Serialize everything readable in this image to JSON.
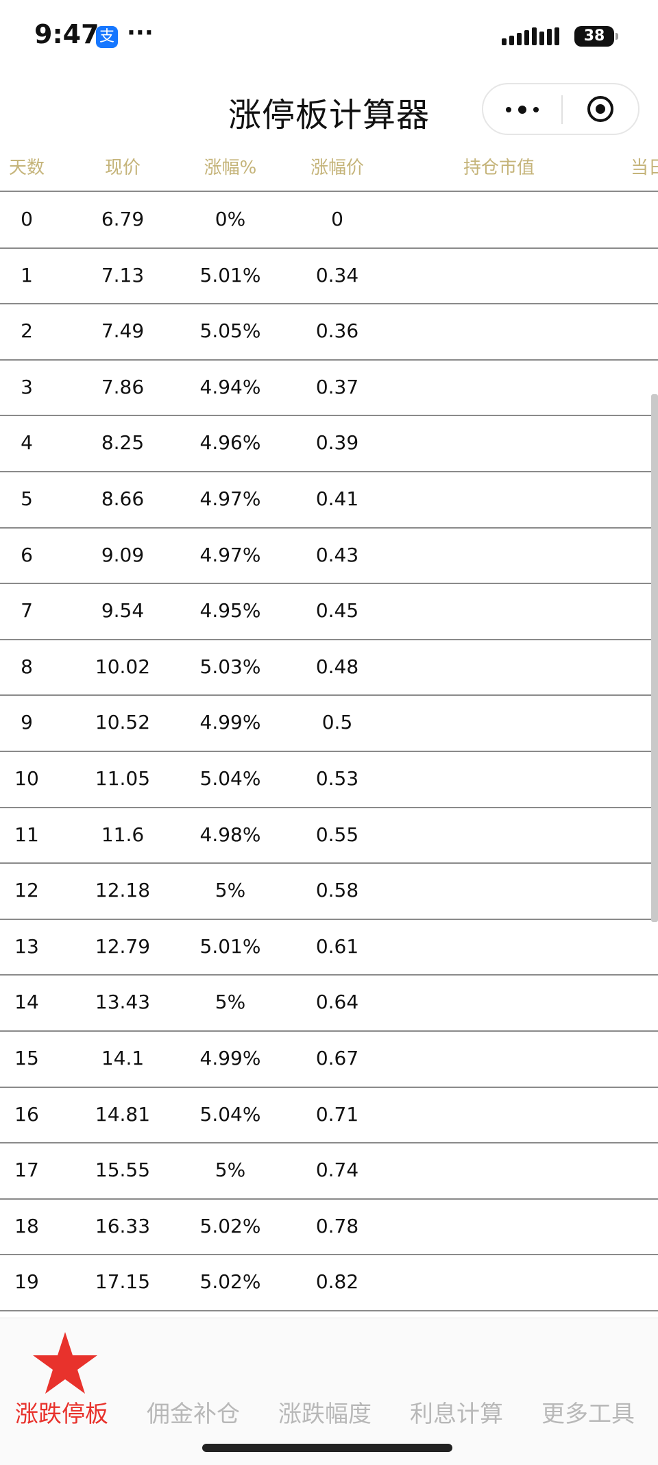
{
  "status_bar": {
    "time": "9:47",
    "more": "···",
    "battery": "38"
  },
  "nav": {
    "title": "涨停板计算器"
  },
  "table": {
    "headers": [
      "天数",
      "现价",
      "涨幅%",
      "涨幅价",
      "持仓市值",
      "当日"
    ],
    "rows": [
      {
        "day": "0",
        "price": "6.79",
        "pct": "0%",
        "amt": "0"
      },
      {
        "day": "1",
        "price": "7.13",
        "pct": "5.01%",
        "amt": "0.34"
      },
      {
        "day": "2",
        "price": "7.49",
        "pct": "5.05%",
        "amt": "0.36"
      },
      {
        "day": "3",
        "price": "7.86",
        "pct": "4.94%",
        "amt": "0.37"
      },
      {
        "day": "4",
        "price": "8.25",
        "pct": "4.96%",
        "amt": "0.39"
      },
      {
        "day": "5",
        "price": "8.66",
        "pct": "4.97%",
        "amt": "0.41"
      },
      {
        "day": "6",
        "price": "9.09",
        "pct": "4.97%",
        "amt": "0.43"
      },
      {
        "day": "7",
        "price": "9.54",
        "pct": "4.95%",
        "amt": "0.45"
      },
      {
        "day": "8",
        "price": "10.02",
        "pct": "5.03%",
        "amt": "0.48"
      },
      {
        "day": "9",
        "price": "10.52",
        "pct": "4.99%",
        "amt": "0.5"
      },
      {
        "day": "10",
        "price": "11.05",
        "pct": "5.04%",
        "amt": "0.53"
      },
      {
        "day": "11",
        "price": "11.6",
        "pct": "4.98%",
        "amt": "0.55"
      },
      {
        "day": "12",
        "price": "12.18",
        "pct": "5%",
        "amt": "0.58"
      },
      {
        "day": "13",
        "price": "12.79",
        "pct": "5.01%",
        "amt": "0.61"
      },
      {
        "day": "14",
        "price": "13.43",
        "pct": "5%",
        "amt": "0.64"
      },
      {
        "day": "15",
        "price": "14.1",
        "pct": "4.99%",
        "amt": "0.67"
      },
      {
        "day": "16",
        "price": "14.81",
        "pct": "5.04%",
        "amt": "0.71"
      },
      {
        "day": "17",
        "price": "15.55",
        "pct": "5%",
        "amt": "0.74"
      },
      {
        "day": "18",
        "price": "16.33",
        "pct": "5.02%",
        "amt": "0.78"
      },
      {
        "day": "19",
        "price": "17.15",
        "pct": "5.02%",
        "amt": "0.82"
      }
    ]
  },
  "tabs": [
    "涨跌停板",
    "佣金补仓",
    "涨跌幅度",
    "利息计算",
    "更多工具"
  ],
  "colors": {
    "header_text": "#c5b47a",
    "active_tab": "#e8322c",
    "inactive_tab": "#b8b8b8",
    "star": "#e8322c"
  }
}
